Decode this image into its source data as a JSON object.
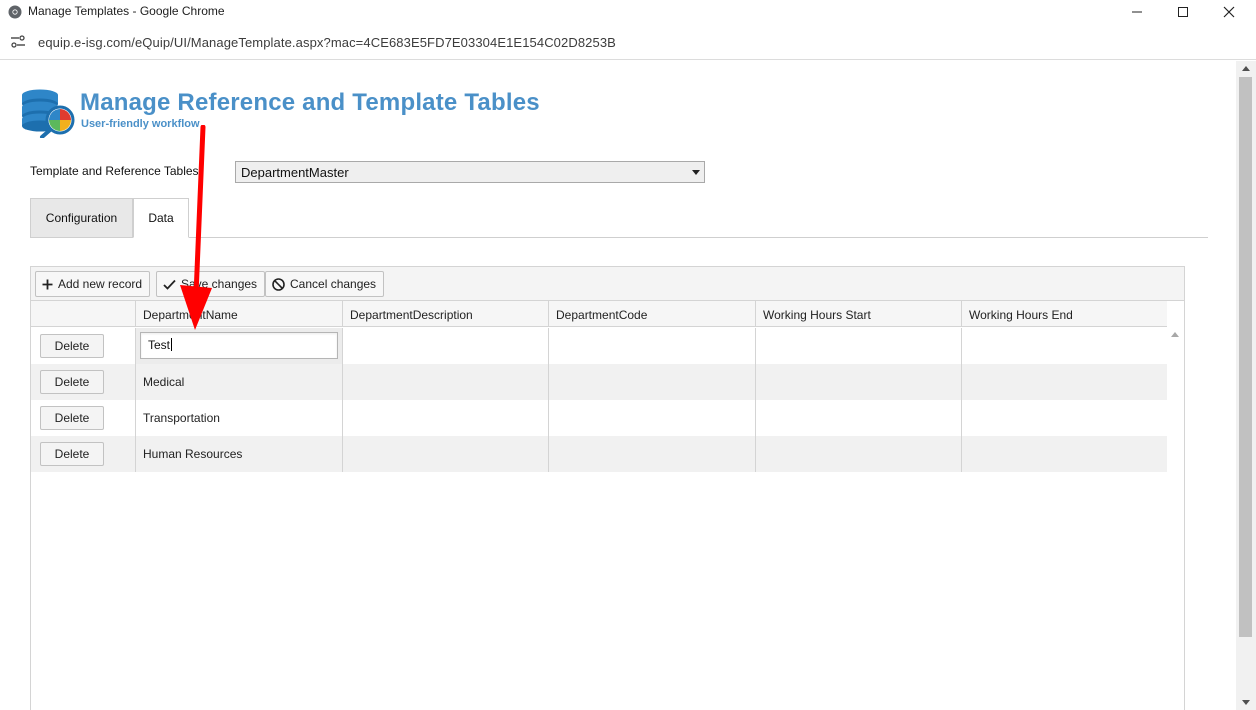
{
  "browser": {
    "window_title": "Manage Templates - Google Chrome",
    "url": "equip.e-isg.com/eQuip/UI/ManageTemplate.aspx?mac=4CE683E5FD7E03304E1E154C02D8253B"
  },
  "page": {
    "title": "Manage Reference and Template Tables",
    "subtitle": "User-friendly workflow",
    "table_select_label": "Template and Reference Tables",
    "table_select_value": "DepartmentMaster"
  },
  "tabs": [
    {
      "label": "Configuration",
      "active": false
    },
    {
      "label": "Data",
      "active": true
    }
  ],
  "toolbar": {
    "add_label": "Add new record",
    "save_label": "Save changes",
    "cancel_label": "Cancel changes"
  },
  "grid": {
    "columns": [
      "",
      "DepartmentName",
      "DepartmentDescription",
      "DepartmentCode",
      "Working Hours Start",
      "Working Hours End"
    ],
    "delete_label": "Delete",
    "editing_value": "Test",
    "rows": [
      {
        "name": "Test",
        "description": "",
        "code": "",
        "start": "",
        "end": ""
      },
      {
        "name": "Medical",
        "description": "",
        "code": "",
        "start": "",
        "end": ""
      },
      {
        "name": "Transportation",
        "description": "",
        "code": "",
        "start": "",
        "end": ""
      },
      {
        "name": "Human Resources",
        "description": "",
        "code": "",
        "start": "",
        "end": ""
      }
    ]
  },
  "colors": {
    "title_blue": "#4a90c8",
    "annotation_red": "#ff0000"
  }
}
